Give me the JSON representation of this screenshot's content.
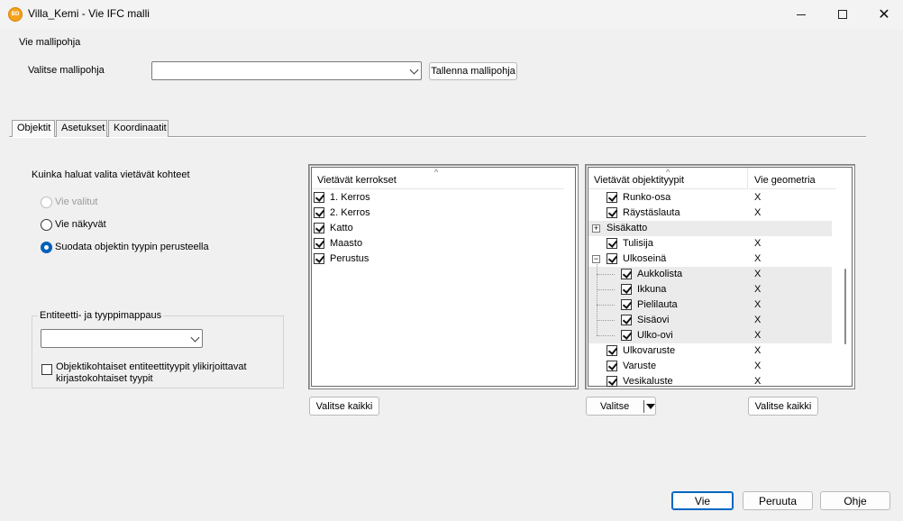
{
  "window": {
    "title": "Villa_Kemi - Vie IFC malli",
    "app_icon_text": "BD"
  },
  "template_section": {
    "title": "Vie mallipohja",
    "select_label": "Valitse mallipohja",
    "select_value": "",
    "save_button": "Tallenna mallipohja"
  },
  "tabs": [
    {
      "label": "Objektit",
      "active": true
    },
    {
      "label": "Asetukset",
      "active": false
    },
    {
      "label": "Koordinaatit",
      "active": false
    }
  ],
  "export_options": {
    "heading": "Kuinka haluat valita vietävät kohteet",
    "options": [
      {
        "label": "Vie valitut",
        "checked": false,
        "disabled": true
      },
      {
        "label": "Vie näkyvät",
        "checked": false,
        "disabled": false
      },
      {
        "label": "Suodata objektin tyypin perusteella",
        "checked": true,
        "disabled": false
      }
    ]
  },
  "entity_mapping": {
    "group_title": "Entiteetti- ja tyyppimappaus",
    "combo_value": "",
    "override_checkbox_line1": "Objektikohtaiset entiteettityypit ylikirjoittavat",
    "override_checkbox_line2": "kirjastokohtaiset tyypit",
    "override_checked": false
  },
  "floors": {
    "header": "Vietävät kerrokset",
    "items": [
      {
        "label": "1. Kerros",
        "checked": true
      },
      {
        "label": "2. Kerros",
        "checked": true
      },
      {
        "label": "Katto",
        "checked": true
      },
      {
        "label": "Maasto",
        "checked": true
      },
      {
        "label": "Perustus",
        "checked": true
      }
    ],
    "select_all_button": "Valitse kaikki"
  },
  "object_types": {
    "header_type": "Vietävät objektityypit",
    "header_geometry": "Vie geometria",
    "rows": [
      {
        "label": "Runko-osa",
        "checked": true,
        "geometry": "X",
        "level": 0
      },
      {
        "label": "Räystäslauta",
        "checked": true,
        "geometry": "X",
        "level": 0
      },
      {
        "label": "Sisäkatto",
        "checked": null,
        "geometry": "",
        "level": 0,
        "expander": "+"
      },
      {
        "label": "Tulisija",
        "checked": true,
        "geometry": "X",
        "level": 0
      },
      {
        "label": "Ulkoseinä",
        "checked": true,
        "geometry": "X",
        "level": 0,
        "expander": "−"
      },
      {
        "label": "Aukkolista",
        "checked": true,
        "geometry": "X",
        "level": 1
      },
      {
        "label": "Ikkuna",
        "checked": true,
        "geometry": "X",
        "level": 1
      },
      {
        "label": "Pielilauta",
        "checked": true,
        "geometry": "X",
        "level": 1
      },
      {
        "label": "Sisäovi",
        "checked": true,
        "geometry": "X",
        "level": 1
      },
      {
        "label": "Ulko-ovi",
        "checked": true,
        "geometry": "X",
        "level": 1
      },
      {
        "label": "Ulkovaruste",
        "checked": true,
        "geometry": "X",
        "level": 0
      },
      {
        "label": "Varuste",
        "checked": true,
        "geometry": "X",
        "level": 0
      },
      {
        "label": "Vesikaluste",
        "checked": true,
        "geometry": "X",
        "level": 0
      }
    ],
    "select_button": "Valitse",
    "select_all_button": "Valitse kaikki"
  },
  "footer": {
    "export_button": "Vie",
    "cancel_button": "Peruuta",
    "help_button": "Ohje"
  }
}
